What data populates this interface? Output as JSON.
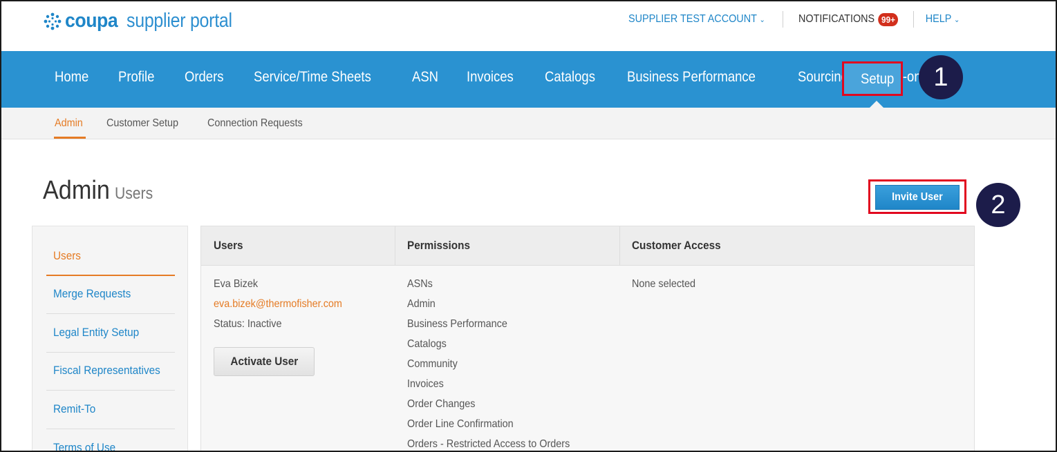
{
  "brand": {
    "name_bold": "coupa",
    "name_rest": "supplier portal",
    "logo_color": "#1f86c8"
  },
  "header": {
    "account_label": "SUPPLIER TEST ACCOUNT",
    "notifications_label": "NOTIFICATIONS",
    "notifications_count": "99+",
    "help_label": "HELP"
  },
  "nav": {
    "items": [
      "Home",
      "Profile",
      "Orders",
      "Service/Time Sheets",
      "ASN",
      "Invoices",
      "Catalogs",
      "Business Performance",
      "Sourcing",
      "Add-ons"
    ],
    "active": "Setup",
    "color": "#2a92d1"
  },
  "subnav": {
    "items": [
      "Admin",
      "Customer Setup",
      "Connection Requests"
    ],
    "active": "Admin"
  },
  "page": {
    "title": "Admin",
    "subtitle": "Users",
    "invite_button": "Invite User"
  },
  "steps": {
    "one": "1",
    "two": "2"
  },
  "sidebar": {
    "items": [
      "Users",
      "Merge Requests",
      "Legal Entity Setup",
      "Fiscal Representatives",
      "Remit-To",
      "Terms of Use"
    ],
    "active": "Users"
  },
  "table": {
    "headers": [
      "Users",
      "Permissions",
      "Customer Access"
    ],
    "row": {
      "name": "Eva Bizek",
      "email": "eva.bizek@thermofisher.com",
      "status": "Status: Inactive",
      "activate_button": "Activate User",
      "permissions": [
        "ASNs",
        "Admin",
        "Business Performance",
        "Catalogs",
        "Community",
        "Invoices",
        "Order Changes",
        "Order Line Confirmation",
        "Orders - Restricted Access to Orders"
      ],
      "customer_access": "None selected"
    }
  },
  "colors": {
    "accent_orange": "#e57b24",
    "highlight_red": "#e1081f",
    "step_circle": "#1c1c4a"
  }
}
